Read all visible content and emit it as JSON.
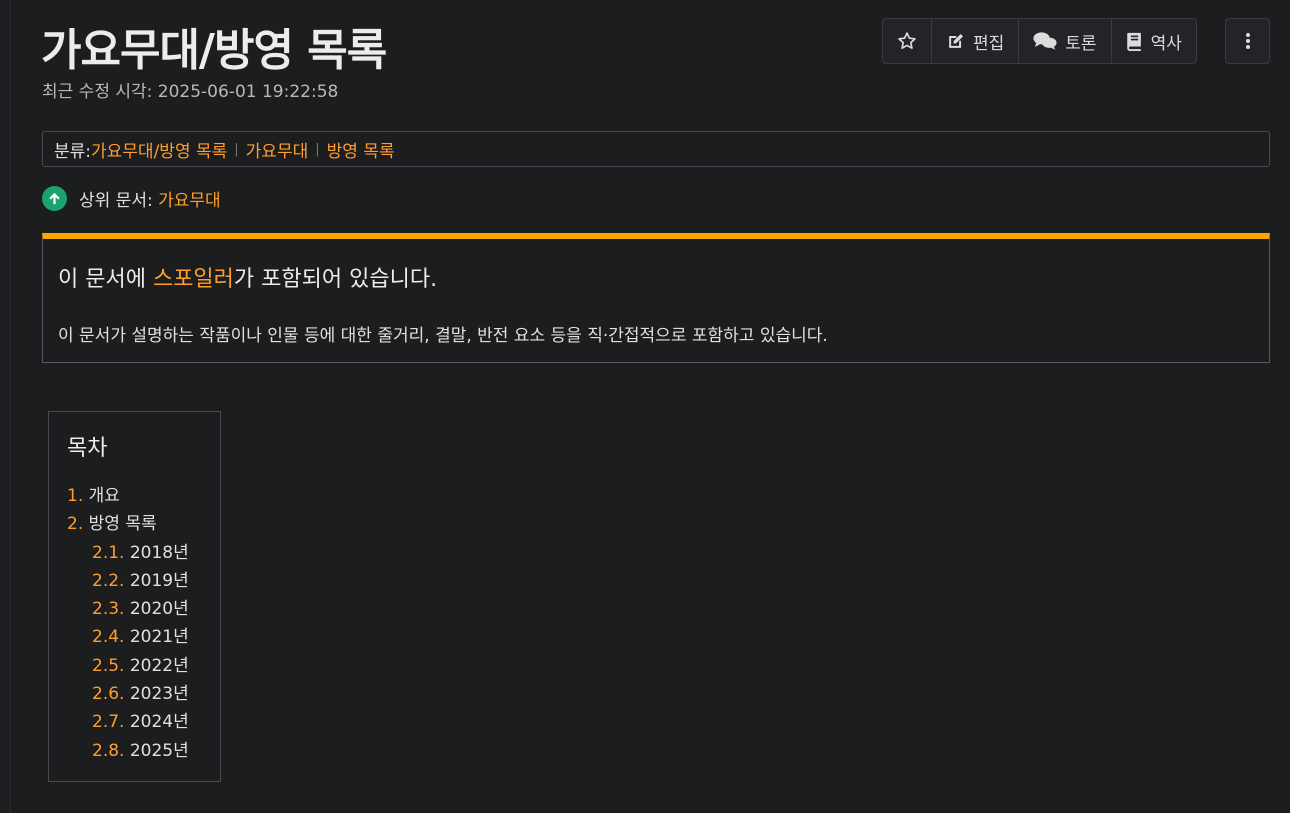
{
  "header": {
    "title": "가요무대/방영 목록",
    "modified": "최근 수정 시각: 2025-06-01 19:22:58"
  },
  "toolbar": {
    "star_icon": "star-icon",
    "edit_label": "편집",
    "discuss_label": "토론",
    "history_label": "역사"
  },
  "category": {
    "label": "분류:",
    "items": [
      "가요무대/방영 목록",
      "가요무대",
      "방영 목록"
    ]
  },
  "parent": {
    "label": "상위 문서: ",
    "link": "가요무대"
  },
  "spoiler": {
    "title_prefix": "이 문서에 ",
    "title_link": "스포일러",
    "title_suffix": "가 포함되어 있습니다.",
    "desc": "이 문서가 설명하는 작품이나 인물 등에 대한 줄거리, 결말, 반전 요소 등을 직·간접적으로 포함하고 있습니다.",
    "accent": "#ffa500"
  },
  "toc": {
    "title": "목차",
    "items": [
      {
        "num": "1.",
        "label": "개요"
      },
      {
        "num": "2.",
        "label": "방영 목록"
      },
      {
        "num": "2.1.",
        "label": "2018년"
      },
      {
        "num": "2.2.",
        "label": "2019년"
      },
      {
        "num": "2.3.",
        "label": "2020년"
      },
      {
        "num": "2.4.",
        "label": "2021년"
      },
      {
        "num": "2.5.",
        "label": "2022년"
      },
      {
        "num": "2.6.",
        "label": "2023년"
      },
      {
        "num": "2.7.",
        "label": "2024년"
      },
      {
        "num": "2.8.",
        "label": "2025년"
      }
    ]
  }
}
